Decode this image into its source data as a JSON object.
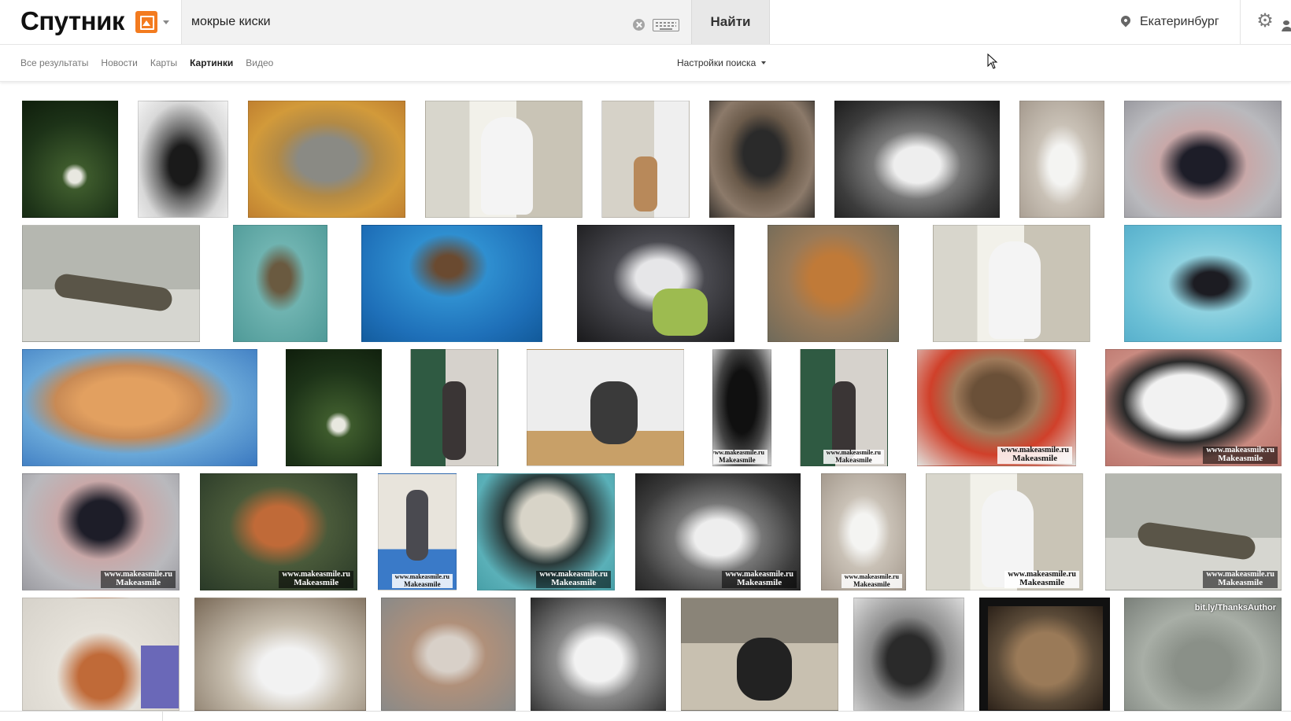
{
  "header": {
    "logo_text": "Спутник",
    "search_value": "мокрые киски",
    "search_button": "Найти",
    "location": "Екатеринбург"
  },
  "nav": {
    "tabs": [
      {
        "label": "Все результаты",
        "active": false
      },
      {
        "label": "Новости",
        "active": false
      },
      {
        "label": "Карты",
        "active": false
      },
      {
        "label": "Картинки",
        "active": true
      },
      {
        "label": "Видео",
        "active": false
      }
    ],
    "search_settings": "Настройки поиска"
  },
  "watermarks": {
    "site": "www.makeasmile.ru",
    "brand": "Makeasmile",
    "credit": "bit.ly/ThanksAuthor"
  },
  "colors": {
    "brand_orange": "#f37b1f",
    "search_bg": "#f2f2f2"
  }
}
